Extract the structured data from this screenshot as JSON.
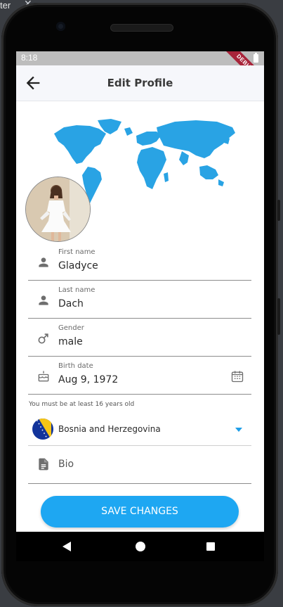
{
  "desktop": {
    "corner_text": "ter",
    "close_glyph": "✕"
  },
  "status_bar": {
    "time": "8:18",
    "battery_icon": "battery-icon"
  },
  "debug_banner": "DEBUG",
  "app_bar": {
    "title": "Edit Profile",
    "back_icon": "arrow-back-icon"
  },
  "header": {
    "map_icon": "world-map",
    "map_color": "#29a3e4",
    "avatar": "profile-photo"
  },
  "fields": {
    "first_name": {
      "label": "First name",
      "value": "Gladyce",
      "icon": "person-icon"
    },
    "last_name": {
      "label": "Last name",
      "value": "Dach",
      "icon": "person-icon"
    },
    "gender": {
      "label": "Gender",
      "value": "male",
      "icon": "male-icon"
    },
    "birth_date": {
      "label": "Birth date",
      "value": "Aug 9, 1972",
      "icon": "cake-icon",
      "trailing_icon": "calendar-icon"
    },
    "birth_hint": "You must be at least 16 years old",
    "country": {
      "value": "Bosnia and Herzegovina",
      "flag": "bosnia-flag",
      "dropdown_icon": "dropdown-arrow-icon"
    },
    "bio": {
      "placeholder": "Bio",
      "icon": "document-icon"
    }
  },
  "save_button": {
    "label": "SAVE CHANGES",
    "color": "#1ea7f2"
  },
  "nav_bar": {
    "back": "back-triangle-icon",
    "home": "home-circle-icon",
    "recents": "recents-square-icon"
  }
}
